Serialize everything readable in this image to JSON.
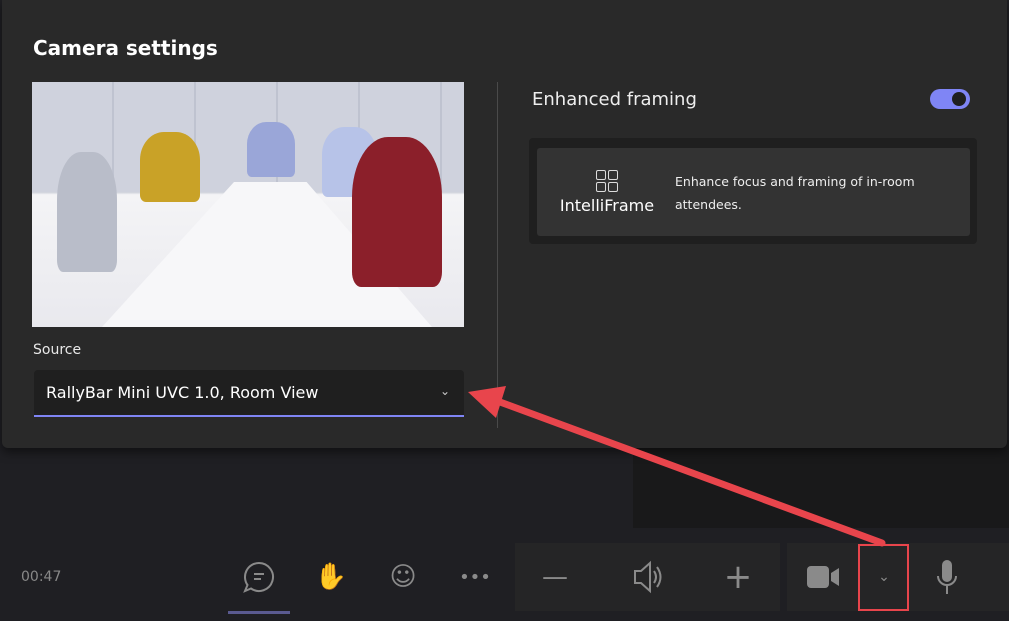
{
  "dialog": {
    "title": "Camera settings"
  },
  "source": {
    "label": "Source",
    "selected": "RallyBar Mini UVC 1.0, Room View"
  },
  "enhanced_framing": {
    "label": "Enhanced framing",
    "enabled": true,
    "accent": "#7f85f5"
  },
  "intelliframe": {
    "name": "IntelliFrame",
    "description": "Enhance focus and framing of in-room attendees.",
    "icon": "grid-icon"
  },
  "toolbar": {
    "time": "00:47",
    "buttons": [
      "chat-icon",
      "raise-hand-icon",
      "reaction-icon",
      "more-icon",
      "volume-down-icon",
      "speaker-icon",
      "volume-up-icon",
      "camera-icon",
      "chevron-down-icon",
      "microphone-icon"
    ]
  },
  "annotation": {
    "color": "#e8454c"
  }
}
